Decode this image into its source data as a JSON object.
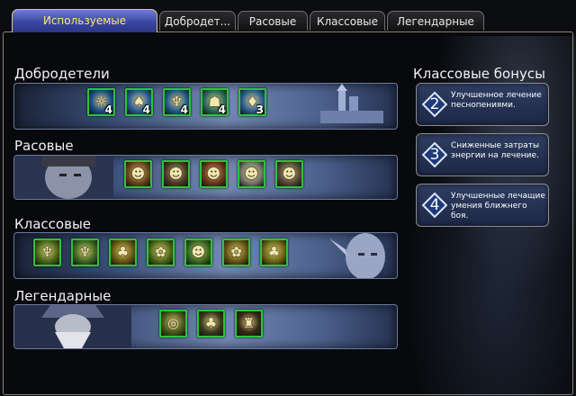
{
  "tabs": [
    {
      "label": "Используемые",
      "active": true
    },
    {
      "label": "Добродет..."
    },
    {
      "label": "Расовые"
    },
    {
      "label": "Классовые"
    },
    {
      "label": "Легендарные"
    }
  ],
  "sections": [
    {
      "title": "Добродетели",
      "slots": [
        {
          "icon": "virtue-icon-1",
          "glyph": "☼",
          "count": "4"
        },
        {
          "icon": "virtue-icon-2",
          "glyph": "♠",
          "count": "4"
        },
        {
          "icon": "virtue-icon-3",
          "glyph": "♆",
          "count": "4"
        },
        {
          "icon": "virtue-icon-4",
          "glyph": "☗",
          "count": "4"
        },
        {
          "icon": "virtue-icon-5",
          "glyph": "♦",
          "count": "3"
        }
      ]
    },
    {
      "title": "Расовые",
      "slots": [
        {
          "icon": "racial-trait-icon-1",
          "glyph": "☻"
        },
        {
          "icon": "racial-trait-icon-2",
          "glyph": "☻"
        },
        {
          "icon": "racial-trait-icon-3",
          "glyph": "☻"
        },
        {
          "icon": "racial-trait-icon-4",
          "glyph": "☻"
        },
        {
          "icon": "racial-trait-icon-5",
          "glyph": "☻"
        }
      ]
    },
    {
      "title": "Классовые",
      "slots": [
        {
          "icon": "class-trait-icon-1",
          "glyph": "♆"
        },
        {
          "icon": "class-trait-icon-2",
          "glyph": "♆"
        },
        {
          "icon": "class-trait-icon-3",
          "glyph": "♣"
        },
        {
          "icon": "class-trait-icon-4",
          "glyph": "✿"
        },
        {
          "icon": "class-trait-icon-5",
          "glyph": "☻"
        },
        {
          "icon": "class-trait-icon-6",
          "glyph": "✿"
        },
        {
          "icon": "class-trait-icon-7",
          "glyph": "♣"
        }
      ]
    },
    {
      "title": "Легендарные",
      "slots": [
        {
          "icon": "legendary-trait-icon-1",
          "glyph": "◎"
        },
        {
          "icon": "legendary-trait-icon-2",
          "glyph": "♣"
        },
        {
          "icon": "legendary-trait-icon-3",
          "glyph": "♜"
        }
      ]
    }
  ],
  "bonuses": {
    "title": "Классовые бонусы",
    "items": [
      {
        "num": "2",
        "text": "Улучшенное лечение песнопениями."
      },
      {
        "num": "3",
        "text": "Сниженные затраты энергии на лечение."
      },
      {
        "num": "4",
        "text": "Улучшенные лечащие умения ближнего боя."
      }
    ]
  },
  "colors": {
    "slot_border": "#2ec23c",
    "active_tab_text": "#ffe96a",
    "active_tab_bg": "#3a46a2"
  }
}
